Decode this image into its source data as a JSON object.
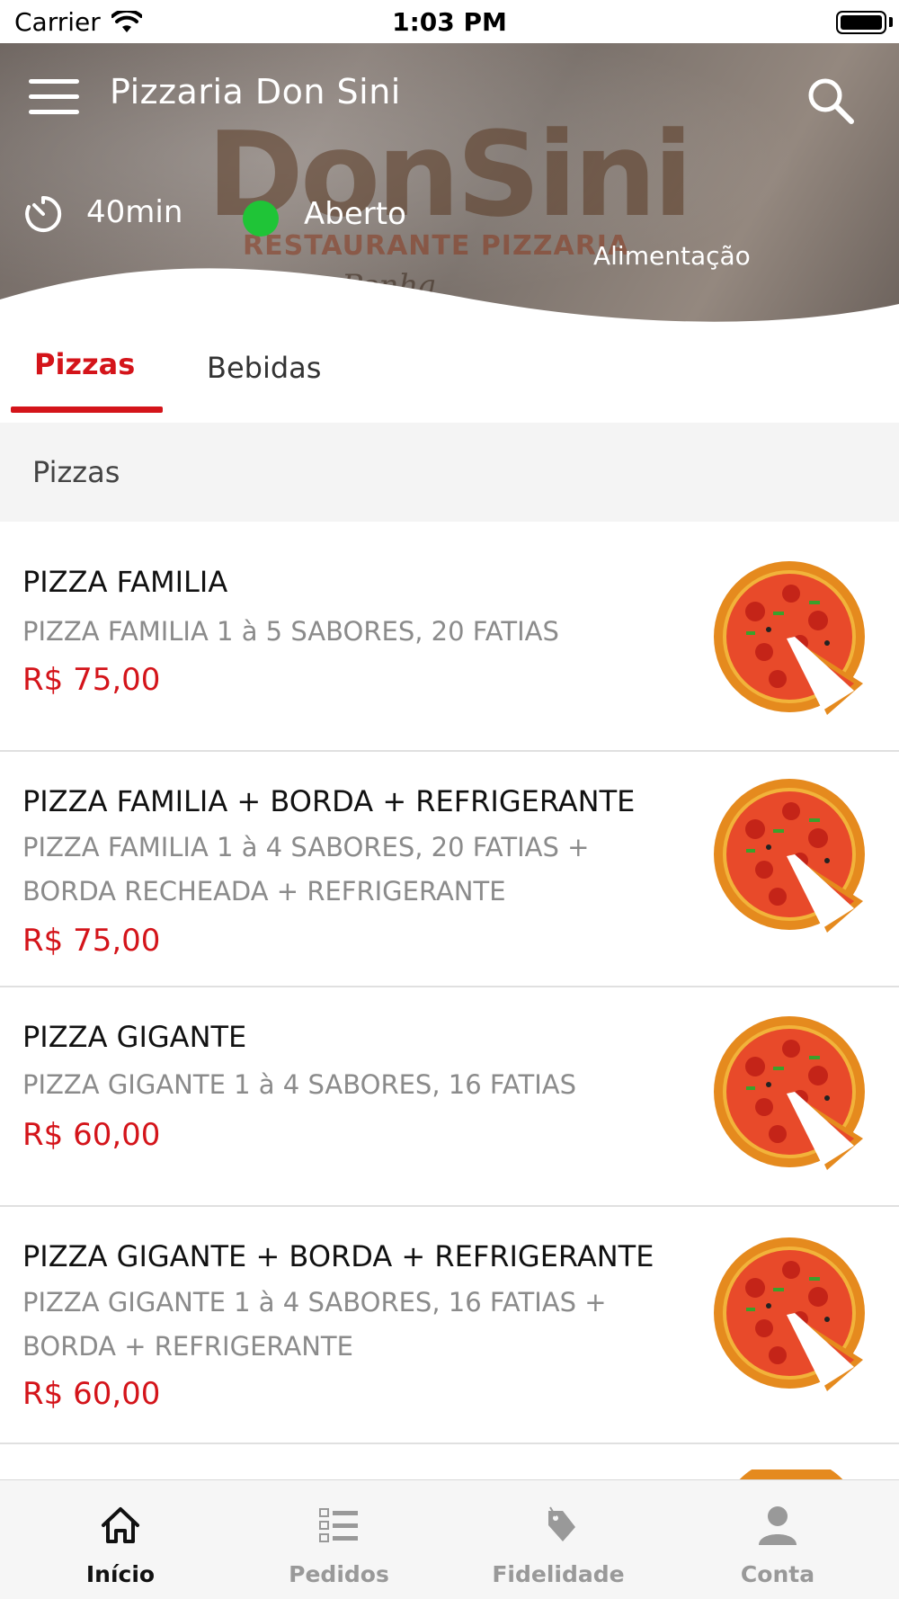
{
  "status_bar": {
    "carrier": "Carrier",
    "time": "1:03 PM"
  },
  "header": {
    "title": "Pizzaria Don Sini",
    "delivery_time": "40min",
    "open_status": "Aberto",
    "category": "Alimentação",
    "status_color": "#1fc437",
    "logo": {
      "brand": "DonSini",
      "subtitle": "RESTAURANTE PIZZARIA",
      "script": "Penha"
    }
  },
  "tabs": [
    {
      "label": "Pizzas",
      "active": true
    },
    {
      "label": "Bebidas",
      "active": false
    }
  ],
  "section": {
    "title": "Pizzas"
  },
  "products": [
    {
      "name": "PIZZA FAMILIA",
      "description": "PIZZA FAMILIA 1 à 5 SABORES, 20 FATIAS",
      "price": "R$ 75,00"
    },
    {
      "name": "PIZZA FAMILIA + BORDA + REFRIGERANTE",
      "description": "PIZZA FAMILIA 1 à 4 SABORES, 20 FATIAS + BORDA RECHEADA + REFRIGERANTE",
      "price": "R$ 75,00"
    },
    {
      "name": "PIZZA GIGANTE",
      "description": "PIZZA GIGANTE 1 à 4 SABORES, 16 FATIAS",
      "price": "R$ 60,00"
    },
    {
      "name": "PIZZA GIGANTE + BORDA + REFRIGERANTE",
      "description": "PIZZA GIGANTE 1 à 4 SABORES, 16 FATIAS + BORDA + REFRIGERANTE",
      "price": "R$ 60,00"
    }
  ],
  "bottom_nav": [
    {
      "label": "Início",
      "icon": "home-icon",
      "active": true
    },
    {
      "label": "Pedidos",
      "icon": "orders-list-icon",
      "active": false
    },
    {
      "label": "Fidelidade",
      "icon": "loyalty-tag-icon",
      "active": false
    },
    {
      "label": "Conta",
      "icon": "account-icon",
      "active": false
    }
  ],
  "colors": {
    "accent": "#d4141a",
    "open": "#1fc437"
  }
}
